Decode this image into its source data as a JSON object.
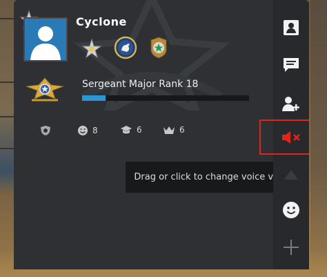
{
  "profile": {
    "username": "Cyclone",
    "rank_title": "Sergeant Major Rank 18",
    "xp_progress": 0.14
  },
  "stats": [
    {
      "icon": "shield-skull-icon",
      "value": ""
    },
    {
      "icon": "smiley-icon",
      "value": "8"
    },
    {
      "icon": "graduation-cap-icon",
      "value": "6"
    },
    {
      "icon": "crown-icon",
      "value": "6"
    }
  ],
  "sidebar": {
    "items": [
      {
        "icon": "profile-card-icon"
      },
      {
        "icon": "chat-icon"
      },
      {
        "icon": "add-friend-icon"
      },
      {
        "icon": "speaker-muted-icon"
      },
      {
        "icon": "smiley-icon"
      },
      {
        "icon": "plus-icon"
      }
    ]
  },
  "tooltip": {
    "text": "Drag or click to change voice volume"
  },
  "colors": {
    "panel": "#2e3033",
    "sidebar": "#27292c",
    "accent_blue": "#2d97d6",
    "mute_red": "#e1251b",
    "avatar_bg": "#2a7ab8"
  }
}
